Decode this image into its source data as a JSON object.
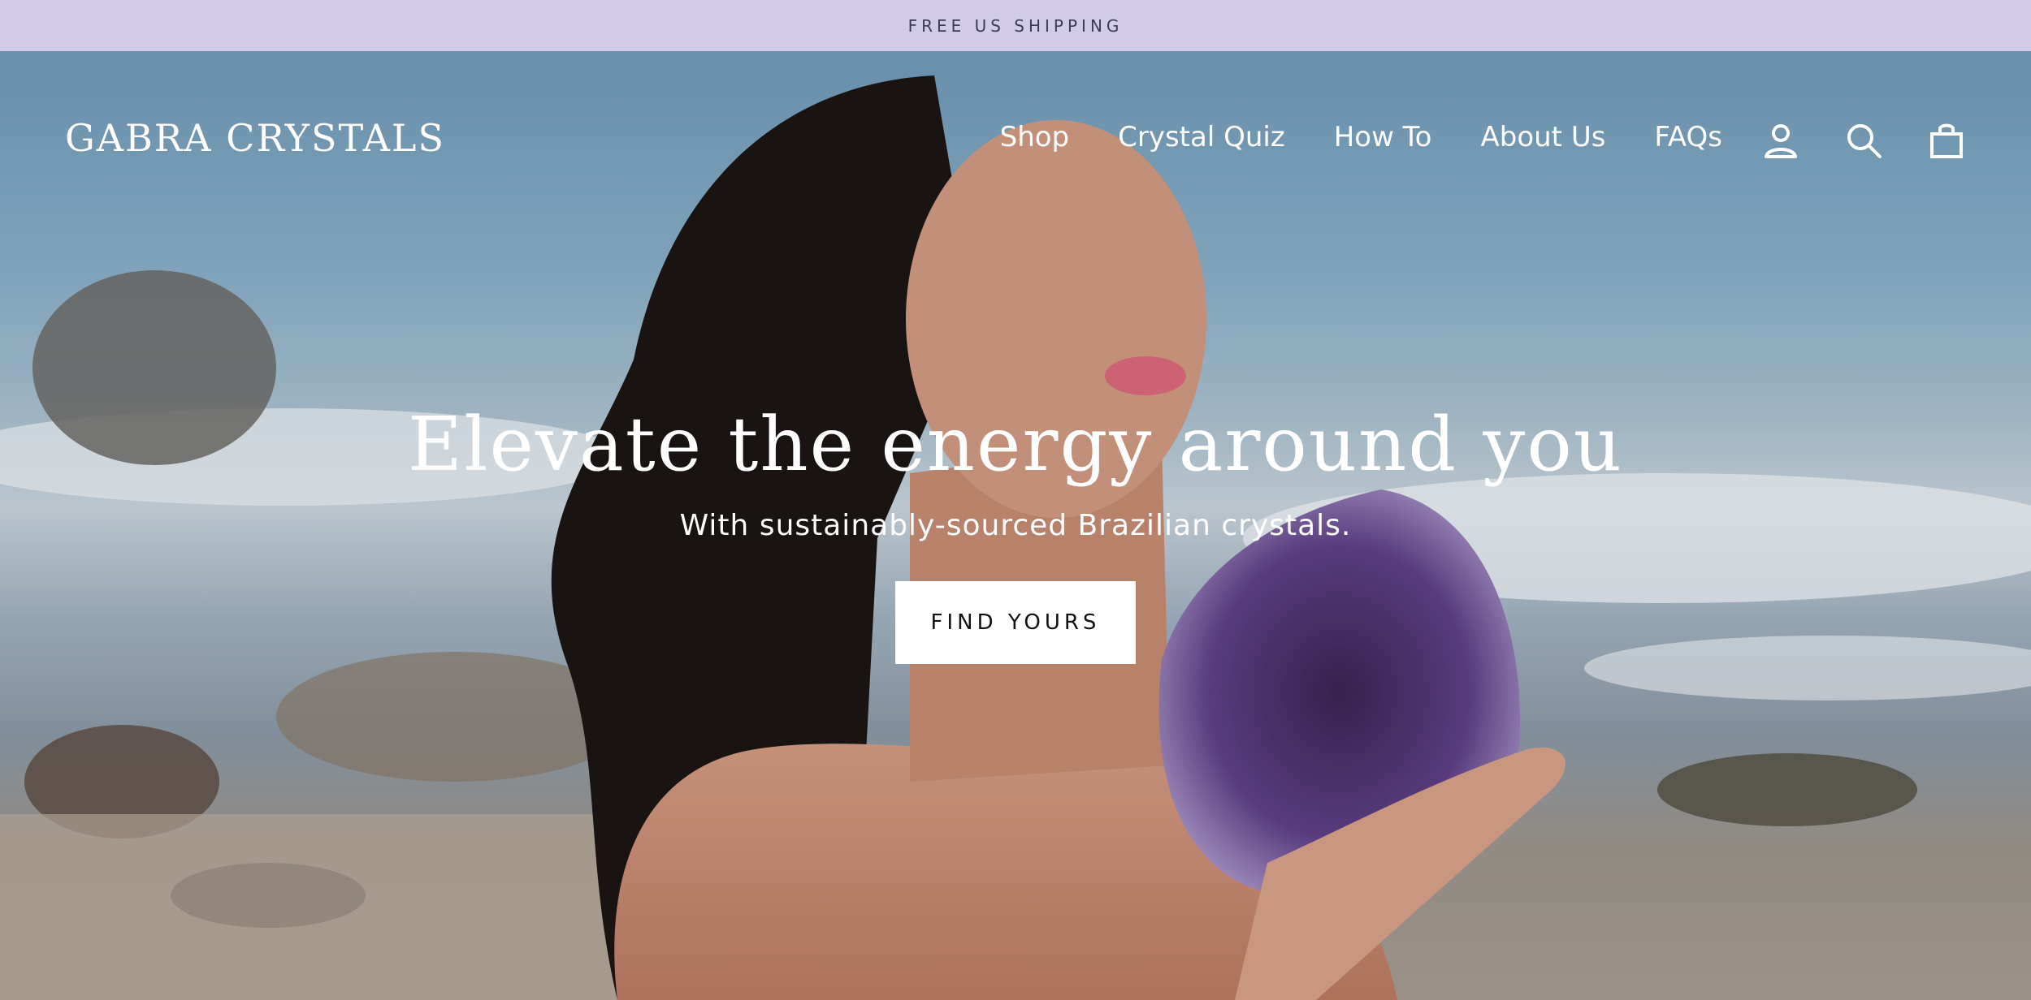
{
  "announcement": {
    "text": "FREE US SHIPPING"
  },
  "header": {
    "logo": "GABRA CRYSTALS",
    "nav": [
      {
        "label": "Shop"
      },
      {
        "label": "Crystal Quiz"
      },
      {
        "label": "How To"
      },
      {
        "label": "About Us"
      },
      {
        "label": "FAQs"
      }
    ],
    "icons": [
      "account-icon",
      "search-icon",
      "cart-icon"
    ]
  },
  "hero": {
    "title": "Elevate the energy around you",
    "subtitle": "With sustainably-sourced Brazilian crystals.",
    "cta_label": "FIND YOURS"
  },
  "colors": {
    "announcement_bg": "#d1cbe8",
    "announcement_text": "#3c3a5a",
    "cta_bg": "#ffffff",
    "cta_text": "#111111",
    "nav_text": "#ffffff"
  }
}
